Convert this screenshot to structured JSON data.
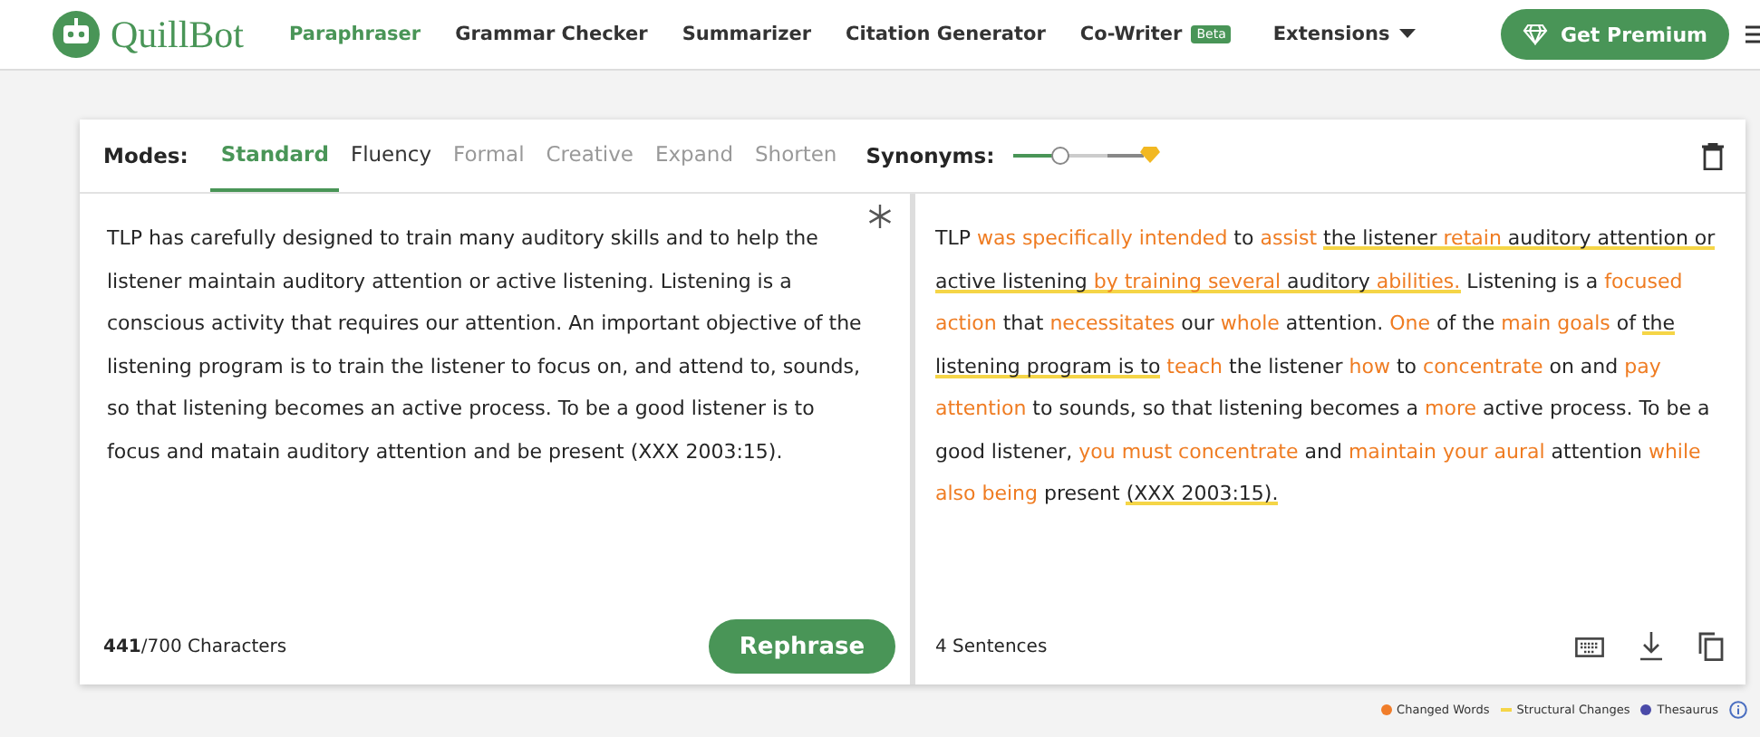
{
  "header": {
    "brand": "QuillBot",
    "nav": [
      {
        "label": "Paraphraser",
        "selected": true
      },
      {
        "label": "Grammar Checker",
        "selected": false
      },
      {
        "label": "Summarizer",
        "selected": false
      },
      {
        "label": "Citation Generator",
        "selected": false
      },
      {
        "label": "Co-Writer",
        "selected": false,
        "badge": "Beta"
      }
    ],
    "extensions": "Extensions",
    "premium": "Get Premium"
  },
  "modes": {
    "label": "Modes:",
    "items": [
      {
        "label": "Standard",
        "selected": true,
        "disabled": false
      },
      {
        "label": "Fluency",
        "selected": false,
        "disabled": false
      },
      {
        "label": "Formal",
        "selected": false,
        "disabled": true
      },
      {
        "label": "Creative",
        "selected": false,
        "disabled": true
      },
      {
        "label": "Expand",
        "selected": false,
        "disabled": true
      },
      {
        "label": "Shorten",
        "selected": false,
        "disabled": true
      }
    ],
    "synonyms_label": "Synonyms:",
    "synonyms_slider": {
      "level": 0.33
    }
  },
  "input": {
    "text": "TLP has carefully designed to train many auditory skills and to help the listener maintain auditory attention or active listening. Listening is a conscious activity that requires our attention. An important objective of the listening program is to train the listener to focus on, and attend to, sounds, so that listening becomes an active process. To be a good listener is to focus and matain auditory attention and be present (XXX 2003:15).",
    "count": "441",
    "limit": "/700 Characters",
    "button": "Rephrase"
  },
  "output": {
    "segments": [
      {
        "text": "TLP ",
        "changed": false,
        "structural": false
      },
      {
        "text": "was specifically intended",
        "changed": true,
        "structural": false
      },
      {
        "text": " to ",
        "changed": false,
        "structural": false
      },
      {
        "text": "assist ",
        "changed": true,
        "structural": false
      },
      {
        "text": "the listener ",
        "changed": false,
        "structural": true
      },
      {
        "text": "retain",
        "changed": true,
        "structural": true
      },
      {
        "text": " auditory attention or active listening ",
        "changed": false,
        "structural": true
      },
      {
        "text": "by training several",
        "changed": true,
        "structural": true
      },
      {
        "text": " auditory ",
        "changed": false,
        "structural": true
      },
      {
        "text": "abilities.",
        "changed": true,
        "structural": true
      },
      {
        "text": " Listening is a ",
        "changed": false,
        "structural": false
      },
      {
        "text": "focused action",
        "changed": true,
        "structural": false
      },
      {
        "text": " that ",
        "changed": false,
        "structural": false
      },
      {
        "text": "necessitates",
        "changed": true,
        "structural": false
      },
      {
        "text": " our ",
        "changed": false,
        "structural": false
      },
      {
        "text": "whole",
        "changed": true,
        "structural": false
      },
      {
        "text": " attention. ",
        "changed": false,
        "structural": false
      },
      {
        "text": "One",
        "changed": true,
        "structural": false
      },
      {
        "text": " of the ",
        "changed": false,
        "structural": false
      },
      {
        "text": "main goals",
        "changed": true,
        "structural": false
      },
      {
        "text": " of ",
        "changed": false,
        "structural": false
      },
      {
        "text": "the listening program is to",
        "changed": false,
        "structural": true
      },
      {
        "text": " teach",
        "changed": true,
        "structural": false
      },
      {
        "text": " the listener ",
        "changed": false,
        "structural": false
      },
      {
        "text": "how",
        "changed": true,
        "structural": false
      },
      {
        "text": " to ",
        "changed": false,
        "structural": false
      },
      {
        "text": "concentrate",
        "changed": true,
        "structural": false
      },
      {
        "text": " on and ",
        "changed": false,
        "structural": false
      },
      {
        "text": "pay attention",
        "changed": true,
        "structural": false
      },
      {
        "text": " to sounds, so that listening becomes a ",
        "changed": false,
        "structural": false
      },
      {
        "text": "more",
        "changed": true,
        "structural": false
      },
      {
        "text": " active process. To be a good listener, ",
        "changed": false,
        "structural": false
      },
      {
        "text": "you must concentrate",
        "changed": true,
        "structural": false
      },
      {
        "text": " and ",
        "changed": false,
        "structural": false
      },
      {
        "text": "maintain your aural",
        "changed": true,
        "structural": false
      },
      {
        "text": " attention ",
        "changed": false,
        "structural": false
      },
      {
        "text": "while also being",
        "changed": true,
        "structural": false
      },
      {
        "text": " present ",
        "changed": false,
        "structural": false
      },
      {
        "text": "(XXX 2003:15).",
        "changed": false,
        "structural": true
      }
    ],
    "sentences": "4 Sentences"
  },
  "legend": [
    {
      "label": "Changed Words",
      "kind": "dot",
      "color": "#f07d2a"
    },
    {
      "label": "Structural Changes",
      "kind": "line",
      "color": "#f5d547"
    },
    {
      "label": "Thesaurus",
      "kind": "dot",
      "color": "#4a4aa8"
    }
  ]
}
